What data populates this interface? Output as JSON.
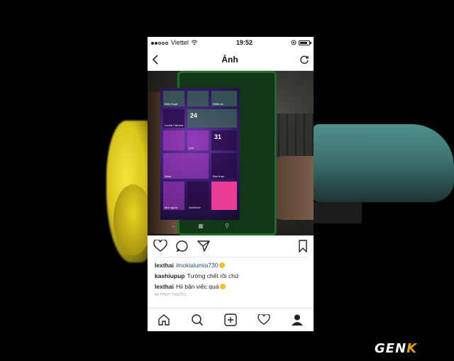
{
  "status_bar": {
    "carrier": "Viettel",
    "time": "19:52",
    "battery_level": 0.8
  },
  "nav": {
    "title": "Ảnh",
    "back_icon": "chevron-left-icon",
    "refresh_icon": "refresh-icon"
  },
  "photo": {
    "phone_tiles": {
      "date_number": "24",
      "tile_31": "31",
      "lumia_camera": "Lumia Camera",
      "music": "Nhạc",
      "people": "Mọi người",
      "onedrive": "OneDrive",
      "alarms": "Báo thức",
      "calendar": "Lịch",
      "photos": "Điện thoại",
      "messages": "Nhắn tin"
    }
  },
  "comments": [
    {
      "user": "lexthai",
      "text": "#nokialumia730",
      "is_tag": true,
      "emoji": true
    },
    {
      "user": "kashiupup",
      "text": "Tướng chết rồi chứ",
      "is_tag": false,
      "emoji": false
    },
    {
      "user": "lexthai",
      "text": "Hii bận việc quá",
      "is_tag": false,
      "emoji": true
    }
  ],
  "time_ago": "46 PHÚT TRƯỚC",
  "tabs": [
    "home-icon",
    "search-icon",
    "add-post-icon",
    "heart-icon",
    "profile-icon"
  ],
  "watermark": {
    "text": "GEN",
    "accent": "K"
  },
  "colors": {
    "tag": "#1d4f91",
    "watermark_accent": "#e8a313",
    "tile_pink": "#e93d95"
  }
}
